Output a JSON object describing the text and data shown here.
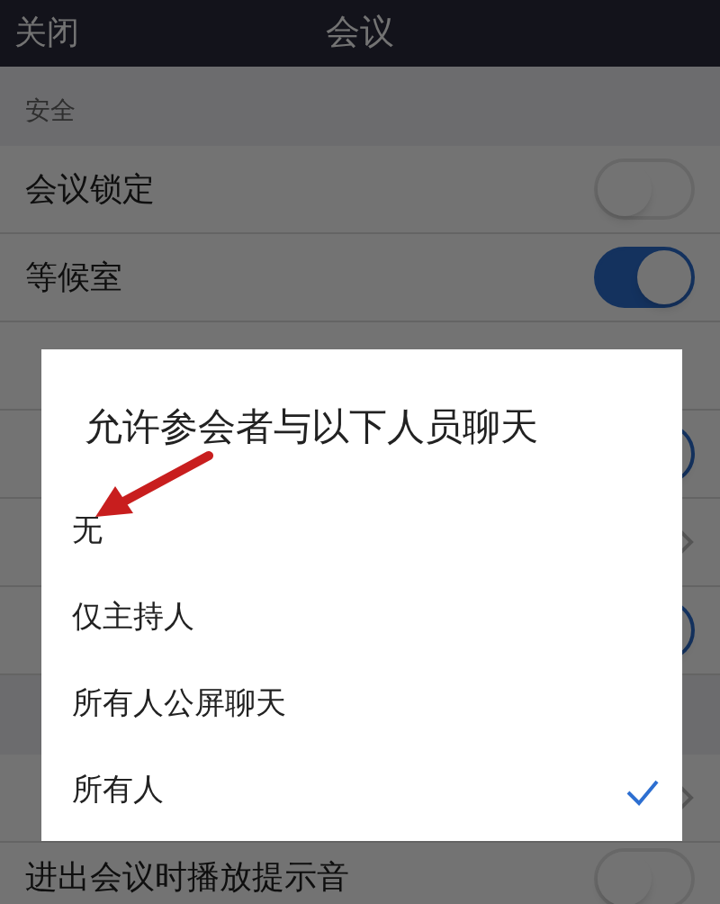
{
  "header": {
    "close": "关闭",
    "title": "会议"
  },
  "rows": [
    {
      "kind": "section",
      "label": "安全"
    },
    {
      "kind": "toggle",
      "label": "会议锁定",
      "on": false
    },
    {
      "kind": "toggle",
      "label": "等候室",
      "on": true
    },
    {
      "kind": "blank"
    },
    {
      "kind": "toggle",
      "on": true
    },
    {
      "kind": "chevron"
    },
    {
      "kind": "toggle",
      "on": true
    },
    {
      "kind": "section"
    },
    {
      "kind": "chevron"
    },
    {
      "kind": "toggle",
      "label": "进出会议时播放提示音",
      "on": false
    }
  ],
  "dialog": {
    "title": "允许参会者与以下人员聊天",
    "options": [
      {
        "label": "无",
        "selected": false
      },
      {
        "label": "仅主持人",
        "selected": false
      },
      {
        "label": "所有人公屏聊天",
        "selected": false
      },
      {
        "label": "所有人",
        "selected": true
      }
    ]
  }
}
